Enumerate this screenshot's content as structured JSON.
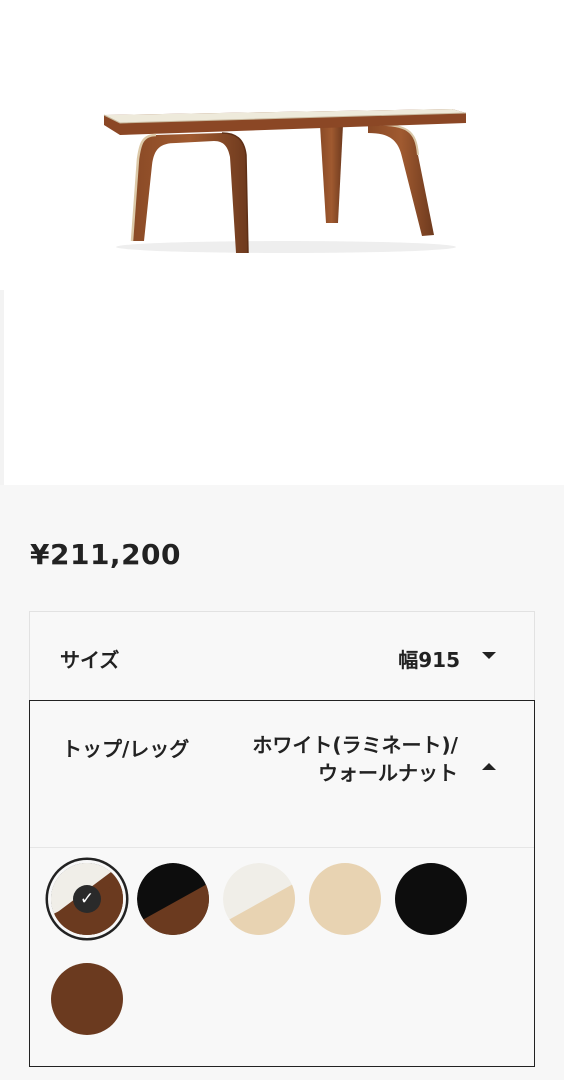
{
  "product": {
    "image_alt": "walnut coffee table with white laminate top",
    "price": "¥211,200"
  },
  "options": {
    "size": {
      "label": "サイズ",
      "value": "幅915",
      "icon": "chevron-down-icon"
    },
    "color": {
      "label": "トップ/レッグ",
      "value": "ホワイト(ラミネート)/ウォールナット",
      "icon": "chevron-up-icon",
      "swatches": [
        {
          "name": "white-laminate-walnut",
          "selected": true
        },
        {
          "name": "black-walnut",
          "selected": false
        },
        {
          "name": "white-ash",
          "selected": false
        },
        {
          "name": "ash",
          "selected": false
        },
        {
          "name": "black",
          "selected": false
        },
        {
          "name": "walnut",
          "selected": false
        }
      ],
      "check_icon": "✓"
    }
  },
  "colors": {
    "walnut": "#6b3a1f",
    "ash": "#e8d3b2",
    "white": "#f0eee8",
    "black": "#0d0d0d",
    "outline": "#222222"
  }
}
